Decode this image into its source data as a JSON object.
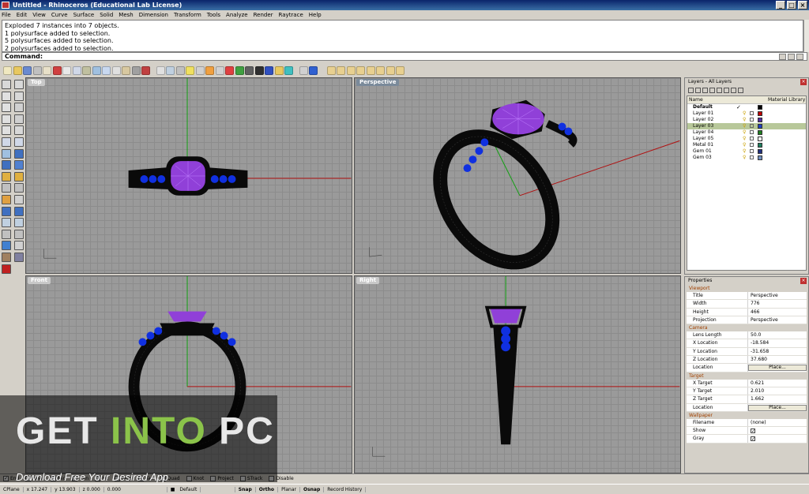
{
  "window": {
    "title": "Untitled - Rhinoceros (Educational Lab License)"
  },
  "menu": [
    "File",
    "Edit",
    "View",
    "Curve",
    "Surface",
    "Solid",
    "Mesh",
    "Dimension",
    "Transform",
    "Tools",
    "Analyze",
    "Render",
    "Raytrace",
    "Help"
  ],
  "command_history": [
    "Exploded 7 instances into 7 objects.",
    "1 polysurface added to selection.",
    "5 polysurfaces added to selection.",
    "2 polysurfaces added to selection."
  ],
  "command_prompt": "Command:",
  "viewports": {
    "top": "Top",
    "perspective": "Perspective",
    "front": "Front",
    "right": "Right"
  },
  "layers_panel": {
    "title": "Layers - All Layers",
    "col_name": "Name",
    "col_material": "Material Library",
    "rows": [
      {
        "name": "Default",
        "color": "#000000",
        "current": true,
        "selected": false
      },
      {
        "name": "Layer 01",
        "color": "#c00000",
        "current": false,
        "selected": false
      },
      {
        "name": "Layer 02",
        "color": "#5030a0",
        "current": false,
        "selected": false
      },
      {
        "name": "Layer 03",
        "color": "#2040c0",
        "current": false,
        "selected": true
      },
      {
        "name": "Layer 04",
        "color": "#208020",
        "current": false,
        "selected": false
      },
      {
        "name": "Layer 05",
        "color": "#ffffff",
        "current": false,
        "selected": false
      },
      {
        "name": "Metal 01",
        "color": "#208060",
        "current": false,
        "selected": false
      },
      {
        "name": "Gem 01",
        "color": "#203080",
        "current": false,
        "selected": false
      },
      {
        "name": "Gem 03",
        "color": "#7090c0",
        "current": false,
        "selected": false
      }
    ]
  },
  "properties": {
    "title": "Properties",
    "sections": {
      "viewport": "Viewport",
      "camera": "Camera",
      "target": "Target",
      "wallpaper": "Wallpaper"
    },
    "viewport_rows": [
      {
        "k": "Title",
        "v": "Perspective"
      },
      {
        "k": "Width",
        "v": "776"
      },
      {
        "k": "Height",
        "v": "466"
      },
      {
        "k": "Projection",
        "v": "Perspective"
      }
    ],
    "camera_rows": [
      {
        "k": "Lens Length",
        "v": "50.0"
      },
      {
        "k": "X Location",
        "v": "-18.584"
      },
      {
        "k": "Y Location",
        "v": "-31.658"
      },
      {
        "k": "Z Location",
        "v": "37.680"
      },
      {
        "k": "Location",
        "v": "Place..."
      }
    ],
    "target_rows": [
      {
        "k": "X Target",
        "v": "0.621"
      },
      {
        "k": "Y Target",
        "v": "2.010"
      },
      {
        "k": "Z Target",
        "v": "1.662"
      },
      {
        "k": "Location",
        "v": "Place..."
      }
    ],
    "wallpaper_rows": [
      {
        "k": "Filename",
        "v": "(none)"
      },
      {
        "k": "Show",
        "v": ""
      },
      {
        "k": "Gray",
        "v": ""
      }
    ]
  },
  "osnap": [
    {
      "label": "End",
      "checked": true
    },
    {
      "label": "Near",
      "checked": false
    },
    {
      "label": "Mid",
      "checked": false
    },
    {
      "label": "Cen",
      "checked": false
    },
    {
      "label": "Int",
      "checked": false
    },
    {
      "label": "Perp",
      "checked": false
    },
    {
      "label": "Tan",
      "checked": false
    },
    {
      "label": "Quad",
      "checked": false
    },
    {
      "label": "Knot",
      "checked": false
    },
    {
      "label": "Project",
      "checked": false
    },
    {
      "label": "STrack",
      "checked": false
    },
    {
      "label": "Disable",
      "checked": false
    }
  ],
  "status": {
    "cplane": "CPlane",
    "x": "x 17.247",
    "y": "y 13.903",
    "z": "z 0.000",
    "delta": "0.000",
    "layer": "Default",
    "snap": "Snap",
    "ortho": "Ortho",
    "planar": "Planar",
    "osnap": "Osnap",
    "history": "Record History"
  },
  "watermark": {
    "get": "GET ",
    "into": "INTO",
    "pc": " PC",
    "sub": "Download Free Your Desired App"
  },
  "colors": {
    "gem": "#9040d8",
    "small_gem": "#1030e0",
    "metal": "#0a0a0a",
    "x_axis": "#b01010",
    "y_axis": "#10a010"
  }
}
